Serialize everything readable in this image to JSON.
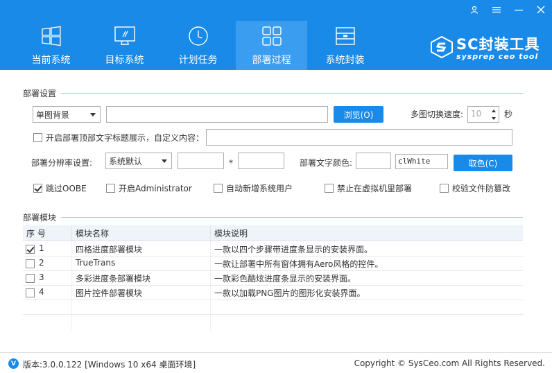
{
  "window": {
    "controls": [
      "user-icon",
      "menu-icon",
      "minimize-icon",
      "close-icon"
    ]
  },
  "tabs": [
    {
      "label": "当前系统",
      "icon": "windows-icon"
    },
    {
      "label": "目标系统",
      "icon": "monitor-icon"
    },
    {
      "label": "计划任务",
      "icon": "clock-icon"
    },
    {
      "label": "部署过程",
      "icon": "grid-icon",
      "active": true
    },
    {
      "label": "系统封装",
      "icon": "drive-icon"
    }
  ],
  "brand": {
    "title": "SC封装工具",
    "subtitle": "sysprep ceo tool"
  },
  "deploy_settings": {
    "section_title": "部署设置",
    "background_mode": "单图背景",
    "background_path": "",
    "browse_label": "浏览(O)",
    "switch_speed_label": "多图切换速度:",
    "switch_speed_value": "10",
    "seconds_unit": "秒",
    "title_text_label": "开启部署顶部文字标题展示，自定义内容：",
    "title_text_value": "",
    "title_text_checked": false,
    "resolution_label": "部署分辨率设置:",
    "resolution_value": "系统默认",
    "width_value": "",
    "times_sign": "*",
    "height_value": "",
    "text_color_label": "部署文字颜色:",
    "color_value": "clWhite",
    "pick_color_label": "取色(C)",
    "options": [
      {
        "label": "跳过OOBE",
        "checked": true
      },
      {
        "label": "开启Administrator",
        "checked": false
      },
      {
        "label": "自动新增系统用户",
        "checked": false
      },
      {
        "label": "禁止在虚拟机里部署",
        "checked": false
      },
      {
        "label": "校验文件防篡改",
        "checked": false
      }
    ]
  },
  "modules": {
    "section_title": "部署模块",
    "columns": [
      "序 号",
      "模块名称",
      "模块说明"
    ],
    "rows": [
      {
        "no": "1",
        "name": "四格进度部署模块",
        "desc": "一款以四个步骤带进度条显示的安装界面。",
        "checked": true
      },
      {
        "no": "2",
        "name": "TrueTrans",
        "desc": "一款让部署中所有窗体拥有Aero风格的控件。",
        "checked": false
      },
      {
        "no": "3",
        "name": "多彩进度条部署模块",
        "desc": "一款彩色酷炫进度条显示的安装界面。",
        "checked": false
      },
      {
        "no": "4",
        "name": "图片控件部署模块",
        "desc": "一款以加载PNG图片的图形化安装界面。",
        "checked": false
      }
    ]
  },
  "footer": {
    "version": "版本:3.0.0.122 [Windows 10 x64 桌面环境]",
    "copyright": "Copyright © SysCeo.com All Rights Reserved."
  }
}
